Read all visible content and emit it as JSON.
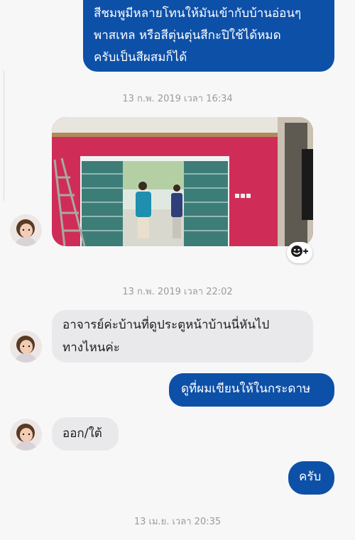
{
  "messages": {
    "m1": {
      "lines": [
        "สีชมพูมีหลายโทนให้มันเข้ากับบ้านอ่อนๆ",
        "พาสเทล หรือสีตุ่นตุ่นสีกะปิใช้ได้หมด",
        "ครับเป็นสีผสมก็ได้"
      ]
    },
    "t1": "13 ก.พ. 2019 เวลา 16:34",
    "t2": "13 ก.พ. 2019 เวลา 22:02",
    "m2": {
      "lines": [
        "อาจารย์ค่ะบ้านที่ดูประตูหน้าบ้านนี่หันไป",
        "ทางไหนค่ะ"
      ]
    },
    "m3": "ดูที่ผมเขียนให้ในกระดาษ",
    "m4": "ออก/ใต้",
    "m5": "ครับ",
    "t3": "13 เม.ย. เวลา 20:35"
  },
  "icons": {
    "avatar": "avatar",
    "reaction": "add-reaction-icon"
  },
  "colors": {
    "outgoing": "#0d50a8",
    "incoming": "#e9e9eb",
    "background": "#f7f7f8"
  }
}
